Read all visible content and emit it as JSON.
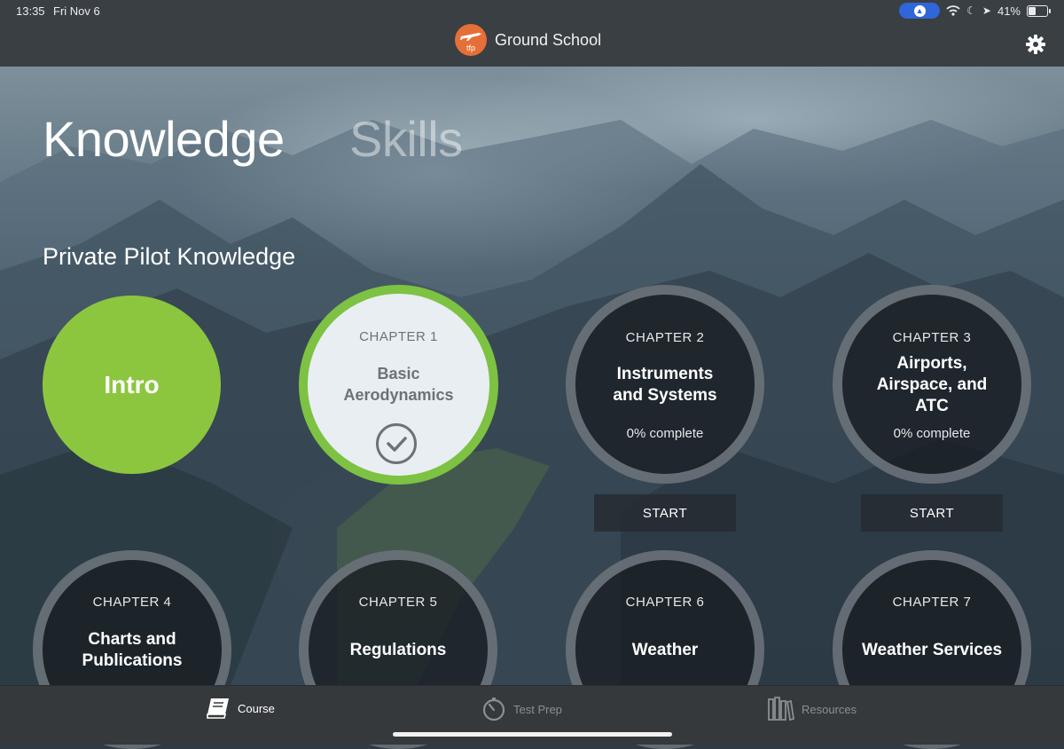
{
  "status_bar": {
    "time": "13:35",
    "date": "Fri Nov 6",
    "battery": "41%"
  },
  "header": {
    "logo_text": "tfp",
    "title": "Ground School",
    "logo_color": "#e56f37"
  },
  "segments": {
    "knowledge": "Knowledge",
    "skills": "Skills",
    "selected": "Knowledge"
  },
  "section": {
    "title": "Private Pilot Knowledge"
  },
  "intro": {
    "label": "Intro",
    "color": "#8cc63f"
  },
  "chapters": [
    {
      "chapter": "CHAPTER 1",
      "name_lines": [
        "Basic",
        "Aerodynamics"
      ],
      "status": "completed"
    },
    {
      "chapter": "CHAPTER 2",
      "name_lines": [
        "Instruments",
        "and Systems"
      ],
      "progress": "0% complete",
      "button": "START"
    },
    {
      "chapter": "CHAPTER 3",
      "name_lines": [
        "Airports,",
        "Airspace, and",
        "ATC"
      ],
      "progress": "0% complete",
      "button": "START"
    },
    {
      "chapter": "CHAPTER 4",
      "name_lines": [
        "Charts and",
        "Publications"
      ]
    },
    {
      "chapter": "CHAPTER 5",
      "name_lines": [
        "Regulations"
      ]
    },
    {
      "chapter": "CHAPTER 6",
      "name_lines": [
        "Weather"
      ]
    },
    {
      "chapter": "CHAPTER 7",
      "name_lines": [
        "Weather Services"
      ]
    }
  ],
  "tabs": [
    {
      "label": "Course",
      "icon": "book-icon",
      "active": true
    },
    {
      "label": "Test Prep",
      "icon": "timer-icon",
      "active": false
    },
    {
      "label": "Resources",
      "icon": "library-icon",
      "active": false
    }
  ],
  "colors": {
    "accent_green": "#7dc242",
    "active_tab": "#ffffff",
    "inactive_tab": "#8b8f93"
  }
}
